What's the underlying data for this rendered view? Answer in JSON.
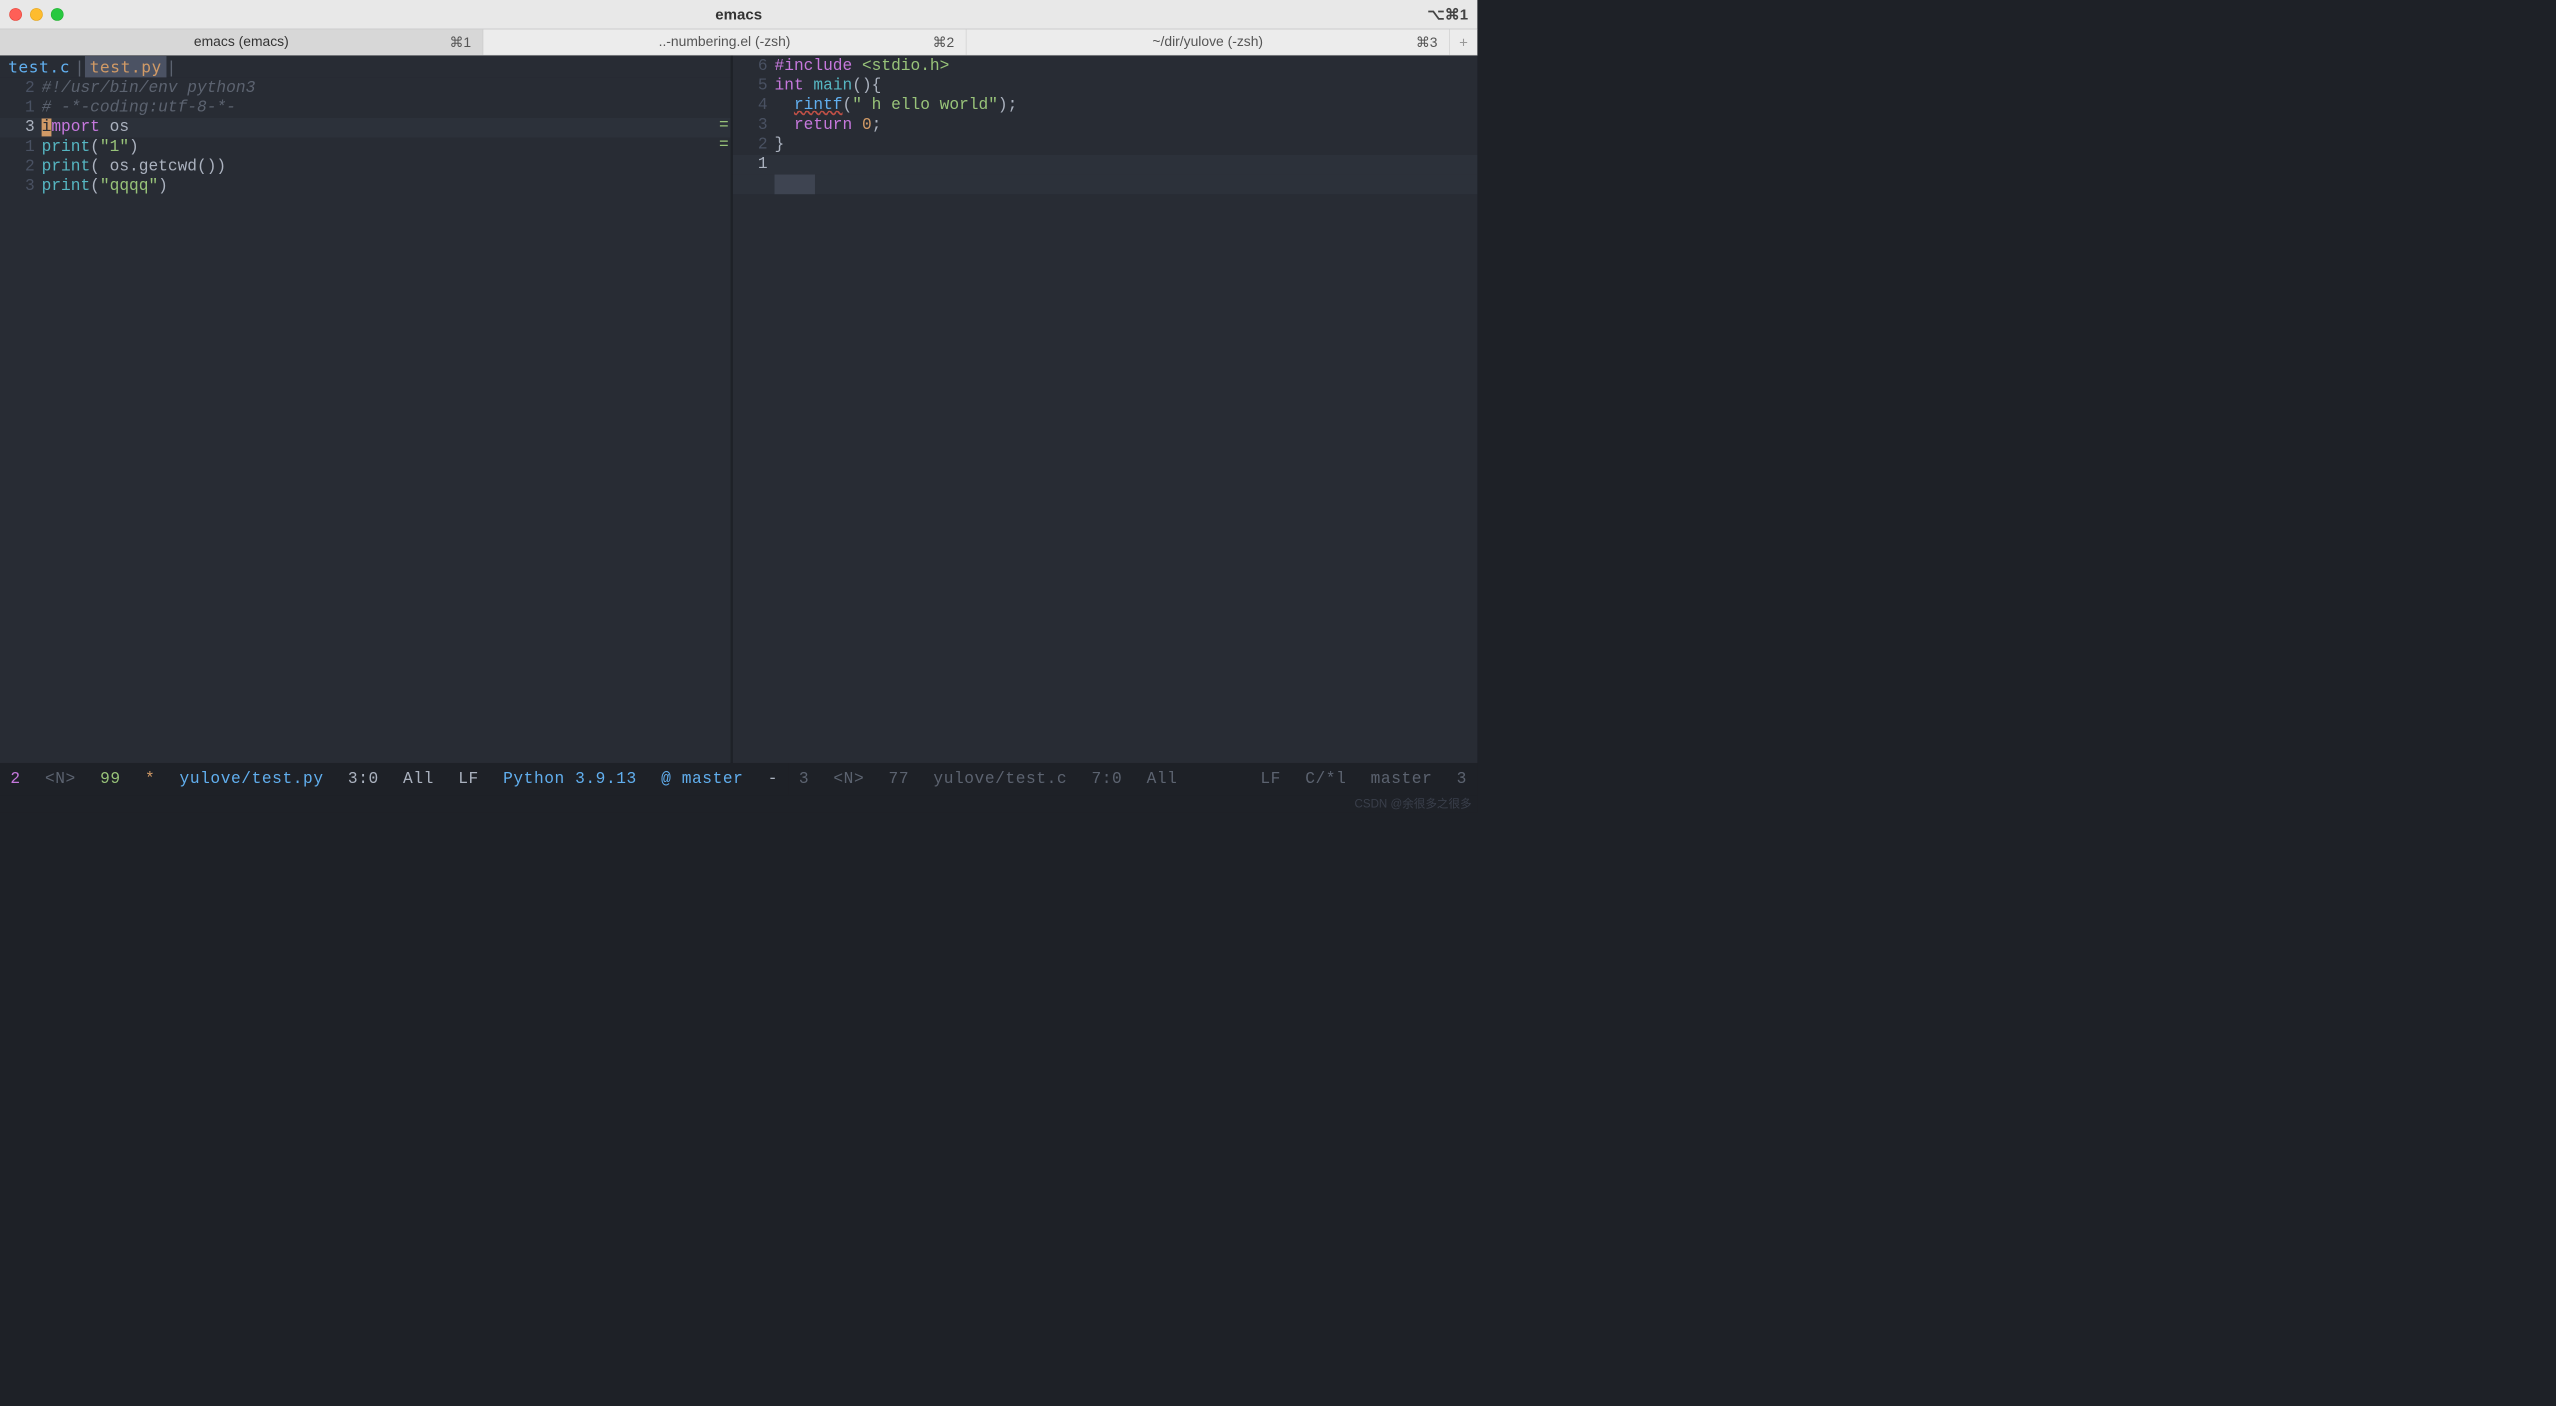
{
  "chrome": {
    "title": "emacs",
    "right_shortcut": "⌥⌘1"
  },
  "window_tabs": [
    {
      "label": "emacs (emacs)",
      "shortcut": "⌘1",
      "active": true
    },
    {
      "label": "..-numbering.el (-zsh)",
      "shortcut": "⌘2",
      "active": false
    },
    {
      "label": "~/dir/yulove (-zsh)",
      "shortcut": "⌘3",
      "active": false
    }
  ],
  "left_pane": {
    "buffer_tabs": {
      "inactive": "test.c",
      "sep1": "|",
      "active": "test.py",
      "sep2": "|"
    },
    "lines": [
      {
        "n": "2",
        "hl": false,
        "tokens": [
          {
            "c": "comment",
            "t": "#!/usr/bin/env python3"
          }
        ]
      },
      {
        "n": "1",
        "hl": false,
        "tokens": [
          {
            "c": "comment",
            "t": "# -*-coding:utf-8-*-"
          }
        ]
      },
      {
        "n": "3",
        "hl": true,
        "cursor_first": "i",
        "tokens": [
          {
            "c": "keyword",
            "t": "mport"
          },
          {
            "c": "code",
            "t": " os"
          }
        ]
      },
      {
        "n": "1",
        "hl": false,
        "tokens": [
          {
            "c": "builtin",
            "t": "print"
          },
          {
            "c": "code",
            "t": "("
          },
          {
            "c": "string",
            "t": "\"1\""
          },
          {
            "c": "code",
            "t": ")"
          }
        ]
      },
      {
        "n": "2",
        "hl": false,
        "tokens": [
          {
            "c": "builtin",
            "t": "print"
          },
          {
            "c": "code",
            "t": "( os.getcwd())"
          }
        ]
      },
      {
        "n": "3",
        "hl": false,
        "tokens": [
          {
            "c": "builtin",
            "t": "print"
          },
          {
            "c": "code",
            "t": "("
          },
          {
            "c": "string",
            "t": "\"qqqq\""
          },
          {
            "c": "code",
            "t": ")"
          }
        ]
      }
    ],
    "diff_marks": [
      {
        "row": 2,
        "ch": "="
      },
      {
        "row": 3,
        "ch": "="
      }
    ]
  },
  "right_pane": {
    "lines": [
      {
        "n": "6",
        "hl": false,
        "tokens": [
          {
            "c": "preproc",
            "t": "#include"
          },
          {
            "c": "code",
            "t": " "
          },
          {
            "c": "string",
            "t": "<stdio.h>"
          }
        ]
      },
      {
        "n": "5",
        "hl": false,
        "tokens": [
          {
            "c": "type",
            "t": "int"
          },
          {
            "c": "code",
            "t": " "
          },
          {
            "c": "builtin",
            "t": "main"
          },
          {
            "c": "code",
            "t": "(){"
          }
        ]
      },
      {
        "n": "4",
        "hl": false,
        "tokens": [
          {
            "c": "code",
            "t": "  "
          },
          {
            "c": "funcname",
            "t": "rintf"
          },
          {
            "c": "code",
            "t": "("
          },
          {
            "c": "string",
            "t": "\" h ello world\""
          },
          {
            "c": "code",
            "t": ");"
          }
        ]
      },
      {
        "n": "3",
        "hl": false,
        "tokens": [
          {
            "c": "code",
            "t": "  "
          },
          {
            "c": "keyword",
            "t": "return"
          },
          {
            "c": "code",
            "t": " "
          },
          {
            "c": "number",
            "t": "0"
          },
          {
            "c": "code",
            "t": ";"
          }
        ]
      },
      {
        "n": "2",
        "hl": false,
        "tokens": [
          {
            "c": "code",
            "t": "}"
          }
        ]
      },
      {
        "n": "1",
        "hl": true,
        "tokens": []
      }
    ],
    "diff_marks": [
      {
        "row": 5,
        "ch": "-"
      }
    ]
  },
  "mode_lines": {
    "left": {
      "win": "2",
      "state": "<N>",
      "col": "99",
      "modified": "*",
      "buffer": "yulove/test.py",
      "pos": "3:0",
      "scroll": "All",
      "eol": "LF",
      "mode": "Python 3.9.13",
      "vc": "@ master",
      "flycheck": "-"
    },
    "right": {
      "win": "3",
      "state": "<N>",
      "col": "77",
      "modified": "",
      "buffer": "yulove/test.c",
      "pos": "7:0",
      "scroll": "All",
      "eol": "LF",
      "mode": "C/*l",
      "vc": "master",
      "flycheck": "3"
    }
  },
  "watermark": "CSDN @余很多之很多"
}
